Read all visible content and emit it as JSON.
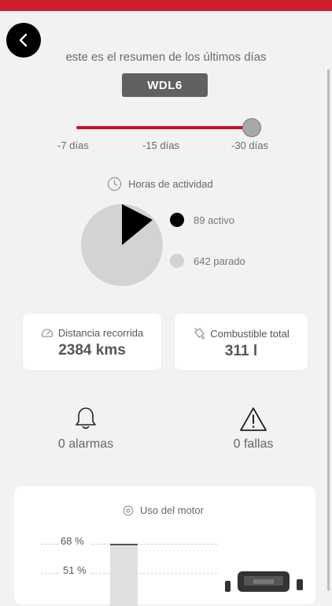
{
  "header": {
    "subtitle": "este es el resumen de los últimos días",
    "vehicle": "WDL6"
  },
  "range": {
    "labels": [
      "-7 días",
      "-15 días",
      "-30 días"
    ],
    "selected": "-30 días"
  },
  "activity": {
    "title": "Horas de actividad",
    "active_label": "89 activo",
    "stopped_label": "642 parado",
    "active_hours": 89,
    "stopped_hours": 642,
    "colors": {
      "active": "#000000",
      "stopped": "#d3d3d3"
    }
  },
  "cards": {
    "distance": {
      "label": "Distancia recorrida",
      "value": "2384 kms"
    },
    "fuel": {
      "label": "Combustible total",
      "value": "311 l"
    }
  },
  "alerts": {
    "alarms": "0 alarmas",
    "failures": "0 fallas"
  },
  "motor": {
    "title": "Uso del motor",
    "levels": [
      "68 %",
      "51 %"
    ],
    "bar_percent": 68
  },
  "colors": {
    "accent": "#cc1f2d",
    "chip": "#616161"
  }
}
